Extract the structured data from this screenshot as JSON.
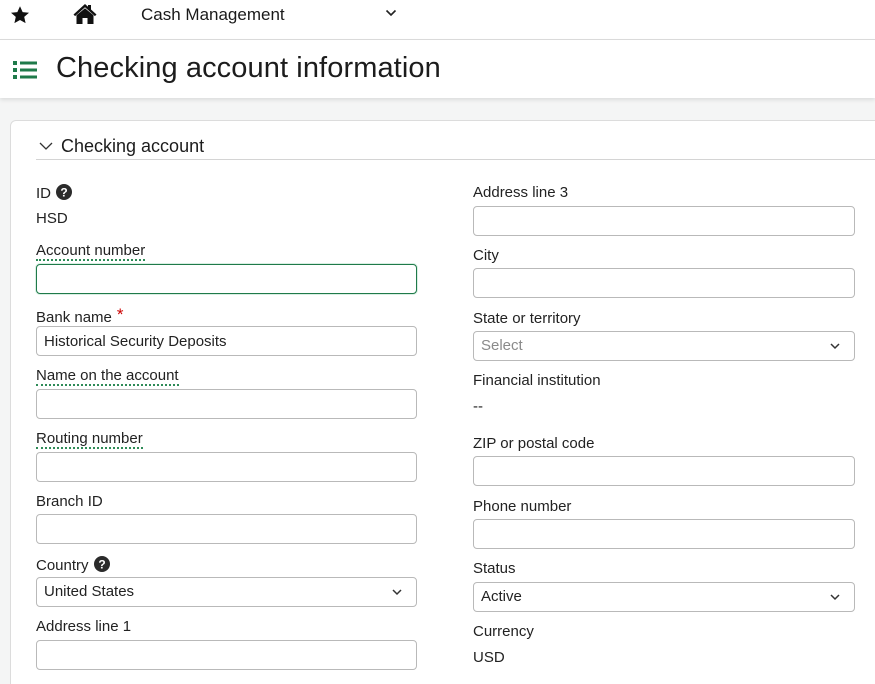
{
  "topbar": {
    "module": "Cash Management"
  },
  "page": {
    "title": "Checking account information"
  },
  "section": {
    "title": "Checking account"
  },
  "left": {
    "id_label": "ID",
    "id_value": "HSD",
    "account_number_label": "Account number",
    "account_number_value": "",
    "bank_name_label": "Bank name",
    "bank_name_required": "*",
    "bank_name_value": "Historical Security Deposits",
    "name_on_account_label": "Name on the account",
    "name_on_account_value": "",
    "routing_number_label": "Routing number",
    "routing_number_value": "",
    "branch_id_label": "Branch ID",
    "branch_id_value": "",
    "country_label": "Country",
    "country_value": "United States",
    "address1_label": "Address line 1",
    "address1_value": ""
  },
  "right": {
    "address3_label": "Address line 3",
    "address3_value": "",
    "city_label": "City",
    "city_value": "",
    "state_label": "State or territory",
    "state_placeholder": "Select",
    "financial_institution_label": "Financial institution",
    "financial_institution_value": "--",
    "zip_label": "ZIP or postal code",
    "zip_value": "",
    "phone_label": "Phone number",
    "phone_value": "",
    "status_label": "Status",
    "status_value": "Active",
    "currency_label": "Currency",
    "currency_value": "USD"
  },
  "colors": {
    "accent": "#1f7a4a",
    "required": "#cc0000"
  },
  "icons": [
    "star-icon",
    "home-icon",
    "chevron-down-icon",
    "list-icon",
    "help-icon"
  ]
}
